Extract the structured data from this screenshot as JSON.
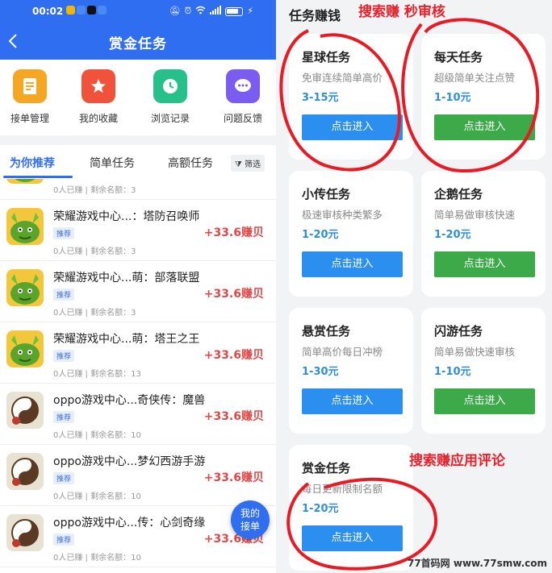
{
  "status": {
    "time": "00:02",
    "app_colors": [
      "#f4b400",
      "#4a8af4",
      "#111111",
      "#4a8af4"
    ],
    "battery_level": 0.8
  },
  "header": {
    "title": "赏金任务"
  },
  "quick_actions": [
    {
      "label": "接单管理",
      "icon": "clipboard-icon",
      "color": "#f5a623"
    },
    {
      "label": "我的收藏",
      "icon": "star-icon",
      "color": "#f0533a"
    },
    {
      "label": "浏览记录",
      "icon": "clock-icon",
      "color": "#27c08a"
    },
    {
      "label": "问题反馈",
      "icon": "chat-icon",
      "color": "#7b5cf0"
    }
  ],
  "tabs": [
    {
      "label": "为你推荐"
    },
    {
      "label": "简单任务"
    },
    {
      "label": "高额任务"
    }
  ],
  "filter_label": "筛选",
  "list": {
    "partial_top": {
      "meta": "0人已赚 | 剩余名额：3"
    },
    "items": [
      {
        "title": "荣耀游戏中心...：塔防召唤师",
        "tag": "推荐",
        "meta": "0人已赚 | 剩余名额：3",
        "reward": "+33.6赚贝",
        "thumb": "green"
      },
      {
        "title": "荣耀游戏中心...萌：部落联盟",
        "tag": "推荐",
        "meta": "0人已赚 | 剩余名额：3",
        "reward": "+33.6赚贝",
        "thumb": "green"
      },
      {
        "title": "荣耀游戏中心...萌：塔王之王",
        "tag": "推荐",
        "meta": "0人已赚 | 剩余名额：13",
        "reward": "+33.6赚贝",
        "thumb": "green"
      },
      {
        "title": "oppo游戏中心...奇侠传：魔兽",
        "tag": "推荐",
        "meta": "0人已赚 | 剩余名额：10",
        "reward": "+33.6赚贝",
        "thumb": "taiji"
      },
      {
        "title": "oppo游戏中心...梦幻西游手游",
        "tag": "推荐",
        "meta": "0人已赚 | 剩余名额：10",
        "reward": "+33.6赚贝",
        "thumb": "taiji"
      },
      {
        "title": "oppo游戏中心...传：心剑奇缘",
        "tag": "推荐",
        "meta": "0人已赚 | 剩余名额：10",
        "reward": "+33.6赚贝",
        "thumb": "taiji"
      }
    ]
  },
  "fab": {
    "line1": "我的",
    "line2": "接单"
  },
  "right": {
    "section_title": "任务赚钱",
    "note_top": "搜索赚 秒审核",
    "note_mid": "搜索赚应用评论",
    "cards": [
      {
        "name": "星球任务",
        "desc": "免审连续简单高价",
        "reward": "3-15元",
        "button": "点击进入",
        "btn_color": "#2b8ff0"
      },
      {
        "name": "每天任务",
        "desc": "超级简单关注点赞",
        "reward": "1-10元",
        "button": "点击进入",
        "btn_color": "#3daa4a"
      },
      {
        "name": "小传任务",
        "desc": "极速审核种类繁多",
        "reward": "1-20元",
        "button": "点击进入",
        "btn_color": "#2b8ff0"
      },
      {
        "name": "企鹅任务",
        "desc": "简单易做审核快速",
        "reward": "1-20元",
        "button": "点击进入",
        "btn_color": "#3daa4a"
      },
      {
        "name": "悬赏任务",
        "desc": "简单高价每日冲榜",
        "reward": "1-30元",
        "button": "点击进入",
        "btn_color": "#2b8ff0"
      },
      {
        "name": "闪游任务",
        "desc": "简单易做快速审核",
        "reward": "1-10元",
        "button": "点击进入",
        "btn_color": "#3daa4a"
      },
      {
        "name": "赏金任务",
        "desc": "每日更新限制名额",
        "reward": "1-20元",
        "button": "点击进入",
        "btn_color": "#2b8ff0"
      }
    ],
    "watermark": "77首码网 www.77smw.com"
  }
}
